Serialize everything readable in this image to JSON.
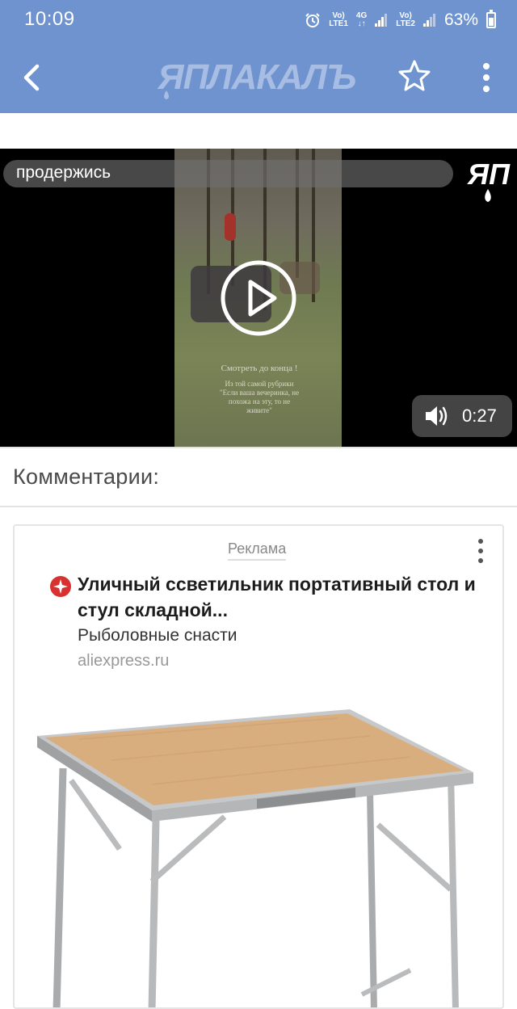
{
  "status_bar": {
    "time": "10:09",
    "net1_top": "Vo)",
    "net1_bottom": "LTE1",
    "net_mid_top": "4G",
    "net2_top": "Vo)",
    "net2_bottom": "LTE2",
    "battery": "63%"
  },
  "app_bar": {
    "logo_text": "ЯПЛАКАЛЪ",
    "colors": {
      "bar": "#6e93cf",
      "logo": "#a7bde3"
    }
  },
  "video": {
    "title": "продержись",
    "badge_text": "ЯП",
    "duration": "0:27",
    "overlay_line1": "Смотреть до конца !",
    "overlay_line2": "Из той самой рубрики",
    "overlay_line3": "\"Если ваша вечеринка, не",
    "overlay_line4": "похожа на эту, то не",
    "overlay_line5": "живите\""
  },
  "comments": {
    "title": "Комментарии:"
  },
  "ad": {
    "label": "Реклама",
    "title": "Уличный ссветильник портативный стол и стул складной...",
    "subtitle": "Рыболовные снасти",
    "domain": "aliexpress.ru"
  }
}
